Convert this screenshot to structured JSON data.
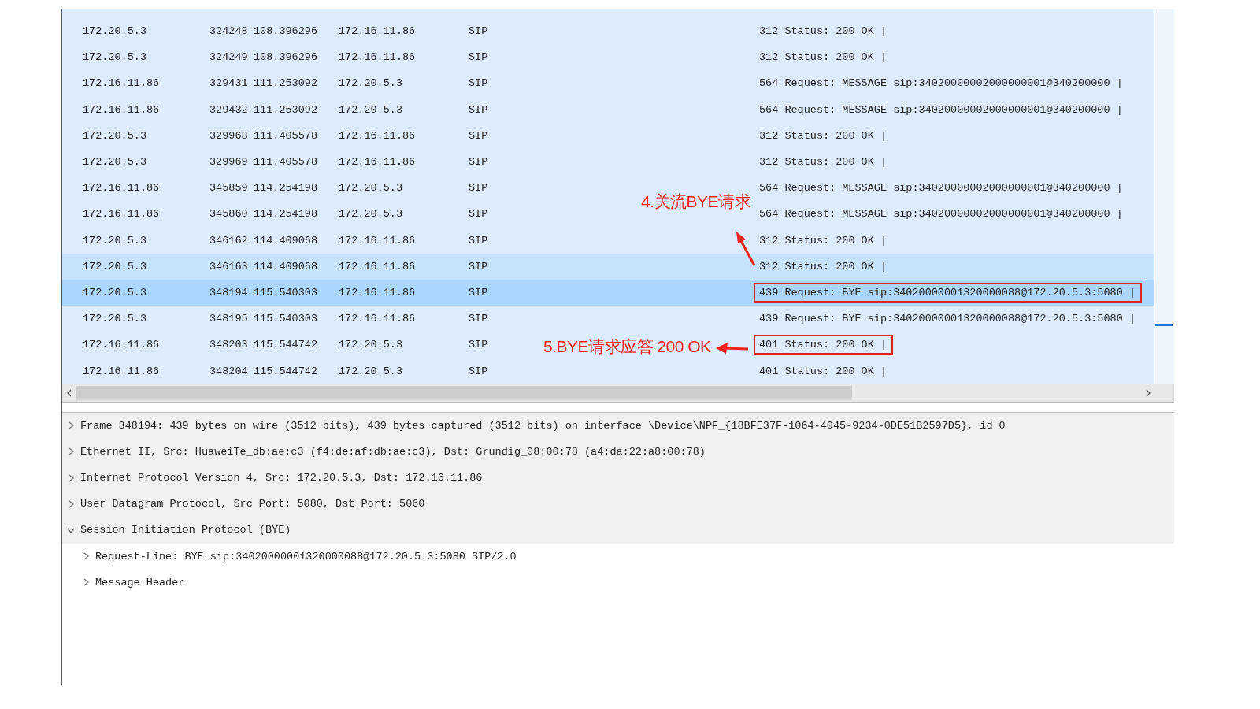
{
  "packet_list": {
    "rows": [
      {
        "source": "172.20.5.3",
        "no": "324248",
        "time": "108.396296",
        "destination": "172.16.11.86",
        "protocol": "SIP",
        "info": "312 Status: 200 OK |",
        "selected": false,
        "hovered": false,
        "outlined": false
      },
      {
        "source": "172.20.5.3",
        "no": "324249",
        "time": "108.396296",
        "destination": "172.16.11.86",
        "protocol": "SIP",
        "info": "312 Status: 200 OK |",
        "selected": false,
        "hovered": false,
        "outlined": false
      },
      {
        "source": "172.16.11.86",
        "no": "329431",
        "time": "111.253092",
        "destination": "172.20.5.3",
        "protocol": "SIP",
        "info": "564 Request: MESSAGE sip:34020000002000000001@340200000 |",
        "selected": false,
        "hovered": false,
        "outlined": false
      },
      {
        "source": "172.16.11.86",
        "no": "329432",
        "time": "111.253092",
        "destination": "172.20.5.3",
        "protocol": "SIP",
        "info": "564 Request: MESSAGE sip:34020000002000000001@340200000 |",
        "selected": false,
        "hovered": false,
        "outlined": false
      },
      {
        "source": "172.20.5.3",
        "no": "329968",
        "time": "111.405578",
        "destination": "172.16.11.86",
        "protocol": "SIP",
        "info": "312 Status: 200 OK |",
        "selected": false,
        "hovered": false,
        "outlined": false
      },
      {
        "source": "172.20.5.3",
        "no": "329969",
        "time": "111.405578",
        "destination": "172.16.11.86",
        "protocol": "SIP",
        "info": "312 Status: 200 OK |",
        "selected": false,
        "hovered": false,
        "outlined": false
      },
      {
        "source": "172.16.11.86",
        "no": "345859",
        "time": "114.254198",
        "destination": "172.20.5.3",
        "protocol": "SIP",
        "info": "564 Request: MESSAGE sip:34020000002000000001@340200000 |",
        "selected": false,
        "hovered": false,
        "outlined": false
      },
      {
        "source": "172.16.11.86",
        "no": "345860",
        "time": "114.254198",
        "destination": "172.20.5.3",
        "protocol": "SIP",
        "info": "564 Request: MESSAGE sip:34020000002000000001@340200000 |",
        "selected": false,
        "hovered": false,
        "outlined": false
      },
      {
        "source": "172.20.5.3",
        "no": "346162",
        "time": "114.409068",
        "destination": "172.16.11.86",
        "protocol": "SIP",
        "info": "312 Status: 200 OK |",
        "selected": false,
        "hovered": false,
        "outlined": false
      },
      {
        "source": "172.20.5.3",
        "no": "346163",
        "time": "114.409068",
        "destination": "172.16.11.86",
        "protocol": "SIP",
        "info": "312 Status: 200 OK |",
        "selected": false,
        "hovered": true,
        "outlined": false
      },
      {
        "source": "172.20.5.3",
        "no": "348194",
        "time": "115.540303",
        "destination": "172.16.11.86",
        "protocol": "SIP",
        "info": "439 Request: BYE sip:34020000001320000088@172.20.5.3:5080 |",
        "selected": true,
        "hovered": false,
        "outlined": true
      },
      {
        "source": "172.20.5.3",
        "no": "348195",
        "time": "115.540303",
        "destination": "172.16.11.86",
        "protocol": "SIP",
        "info": "439 Request: BYE sip:34020000001320000088@172.20.5.3:5080 |",
        "selected": false,
        "hovered": false,
        "outlined": false
      },
      {
        "source": "172.16.11.86",
        "no": "348203",
        "time": "115.544742",
        "destination": "172.20.5.3",
        "protocol": "SIP",
        "info": "401 Status: 200 OK |",
        "selected": false,
        "hovered": false,
        "outlined": true
      },
      {
        "source": "172.16.11.86",
        "no": "348204",
        "time": "115.544742",
        "destination": "172.20.5.3",
        "protocol": "SIP",
        "info": "401 Status: 200 OK |",
        "selected": false,
        "hovered": false,
        "outlined": false
      }
    ]
  },
  "annotations": [
    {
      "kind": "arrow_up",
      "text": "4.关流BYE请求"
    },
    {
      "kind": "arrow_left",
      "text": "5.BYE请求应答 200 OK"
    }
  ],
  "details": [
    {
      "text": "Frame 348194: 439 bytes on wire (3512 bits), 439 bytes captured (3512 bits) on interface \\Device\\NPF_{18BFE37F-1064-4045-9234-0DE51B2597D5}, id 0",
      "expanded": false
    },
    {
      "text": "Ethernet II, Src: HuaweiTe_db:ae:c3 (f4:de:af:db:ae:c3), Dst: Grundig_08:00:78 (a4:da:22:a8:00:78)",
      "expanded": false
    },
    {
      "text": "Internet Protocol Version 4, Src: 172.20.5.3, Dst: 172.16.11.86",
      "expanded": false
    },
    {
      "text": "User Datagram Protocol, Src Port: 5080, Dst Port: 5060",
      "expanded": false
    },
    {
      "text": "Session Initiation Protocol (BYE)",
      "expanded": true,
      "children": [
        {
          "text": "Request-Line: BYE sip:34020000001320000088@172.20.5.3:5080 SIP/2.0",
          "expanded": false
        },
        {
          "text": "Message Header",
          "expanded": false
        }
      ]
    }
  ]
}
